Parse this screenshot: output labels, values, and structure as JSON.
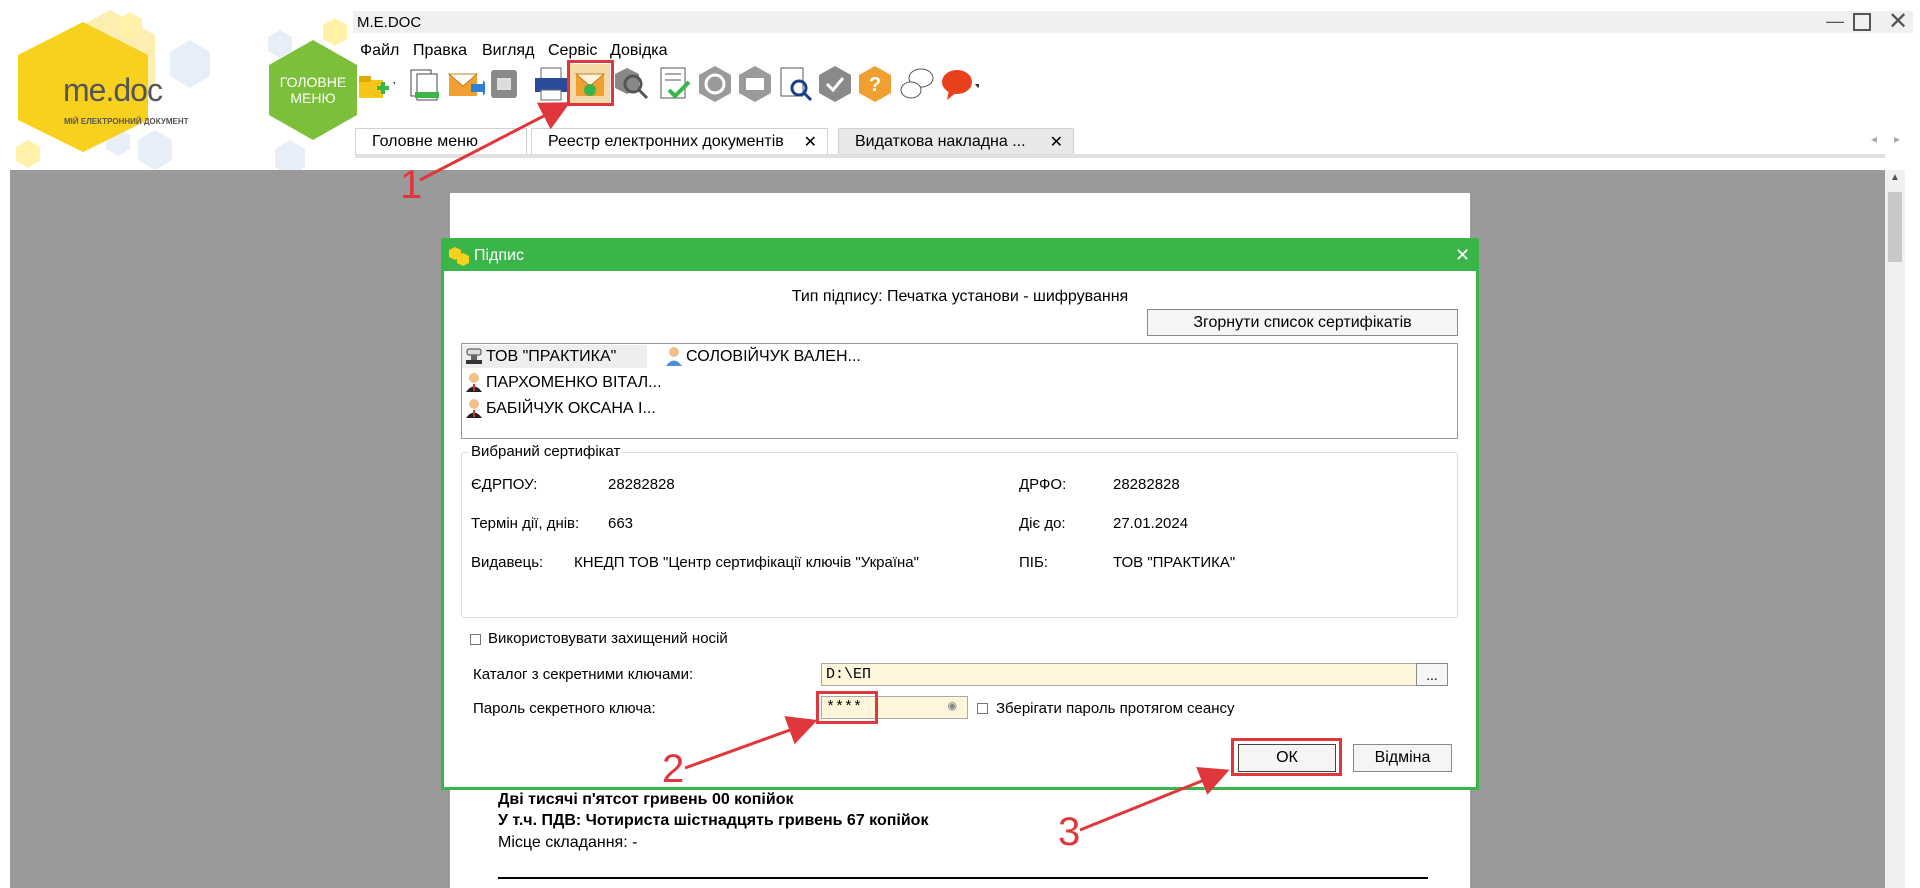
{
  "logo": {
    "name_me": "me",
    "name_doc": "doc",
    "tagline": "МІЙ ЕЛЕКТРОННИЙ ДОКУМЕНТ"
  },
  "main_menu_hex": {
    "line1": "ГОЛОВНЕ",
    "line2": "МЕНЮ"
  },
  "window": {
    "title": "M.E.DOC"
  },
  "menu": [
    "Файл",
    "Правка",
    "Вигляд",
    "Сервіс",
    "Довідка"
  ],
  "toolbar_icons": [
    "new-document-icon",
    "copy-document-icon",
    "send-email-icon",
    "archive-icon",
    "print-icon",
    "sign-document-icon",
    "search-key-icon",
    "checklist-icon",
    "refresh-icon",
    "inbox-icon",
    "find-document-icon",
    "verify-signature-icon",
    "help-icon",
    "feedback-icon",
    "chat-icon"
  ],
  "tabs": [
    {
      "label": "Головне меню",
      "closable": false
    },
    {
      "label": "Реестр електронних документів",
      "closable": true
    },
    {
      "label": "Видаткова накладна ...",
      "closable": true
    }
  ],
  "close_glyph": "✕",
  "dialog": {
    "title": "Підпис",
    "signature_type": "Тип підпису: Печатка установи - шифрування",
    "collapse_button": "Згорнути список сертифікатів",
    "certificates": [
      {
        "name": "ТОВ \"ПРАКТИКА\"",
        "icon": "stamp-icon"
      },
      {
        "name": "СОЛОВІЙЧУК ВАЛЕН...",
        "icon": "user-icon"
      },
      {
        "name": "ПАРХОМЕНКО ВІТАЛ...",
        "icon": "user-icon"
      },
      {
        "name": "БАБІЙЧУК ОКСАНА І...",
        "icon": "user-icon"
      }
    ],
    "selected_group_title": "Вибраний сертифікат",
    "edrpou_label": "ЄДРПОУ:",
    "edrpou": "28282828",
    "drfo_label": "ДРФО:",
    "drfo": "28282828",
    "term_label": "Термін дії, днів:",
    "term": "663",
    "valid_label": "Діє до:",
    "valid": "27.01.2024",
    "issuer_label": "Видавець:",
    "issuer": "КНЕДП ТОВ \"Центр сертифікації ключів \"Україна\"",
    "pib_label": "ПІБ:",
    "pib": "ТОВ \"ПРАКТИКА\"",
    "protected_media_label": "Використовувати захищений носій",
    "keys_dir_label": "Каталог з секретними ключами:",
    "keys_dir": "D:\\ЕП",
    "browse_label": "...",
    "password_label": "Пароль секретного ключа:",
    "password": "****",
    "save_password_label": "Зберігати пароль протягом сеансу",
    "ok_label": "ОК",
    "cancel_label": "Відміна"
  },
  "document_text": {
    "line1": "Дві тисячі п'ятсот гривень 00 копійок",
    "line2": "У т.ч. ПДВ: Чотириста шістнадцять гривень 67 копійок",
    "line3": "Місце складання: -"
  },
  "steps": [
    "1",
    "2",
    "3"
  ],
  "colors": {
    "accent_green": "#3ab54a",
    "annotation_red": "#e0373c",
    "logo_yellow": "#f7d11e",
    "hex_green": "#7cbf3a"
  }
}
